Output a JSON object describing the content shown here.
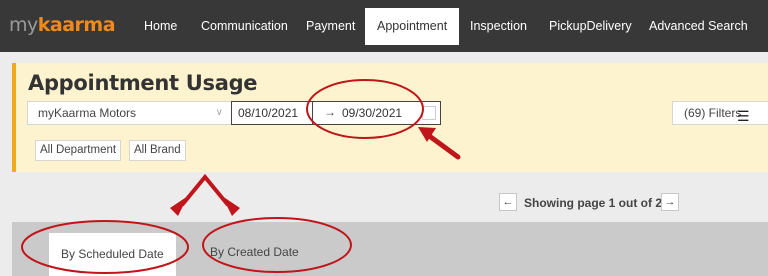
{
  "logo": {
    "part1": "my",
    "part2": "kaarma",
    "brand_color": "#f08a1c"
  },
  "nav": {
    "items": [
      {
        "label": "Home",
        "active": false
      },
      {
        "label": "Communication",
        "active": false
      },
      {
        "label": "Payment",
        "active": false
      },
      {
        "label": "Appointment",
        "active": true
      },
      {
        "label": "Inspection",
        "active": false
      },
      {
        "label": "PickupDelivery",
        "active": false
      },
      {
        "label": "Advanced Search",
        "active": false
      }
    ]
  },
  "panel": {
    "title": "Appointment Usage",
    "dealer_select": "myKaarma Motors",
    "date_from": "08/10/2021",
    "date_to": "09/30/2021",
    "filters_label": "(69) Filters",
    "chips": [
      "All Department",
      "All Brand"
    ]
  },
  "pagination": {
    "prev": "←",
    "text": "Showing page 1 out of 2",
    "next": "→"
  },
  "tabs": [
    {
      "label": "By Scheduled Date",
      "active": true
    },
    {
      "label": "By Created Date",
      "active": false
    }
  ],
  "colors": {
    "annotation": "#c0151a",
    "accent": "#f0a81d",
    "nav_bg": "#383838"
  }
}
